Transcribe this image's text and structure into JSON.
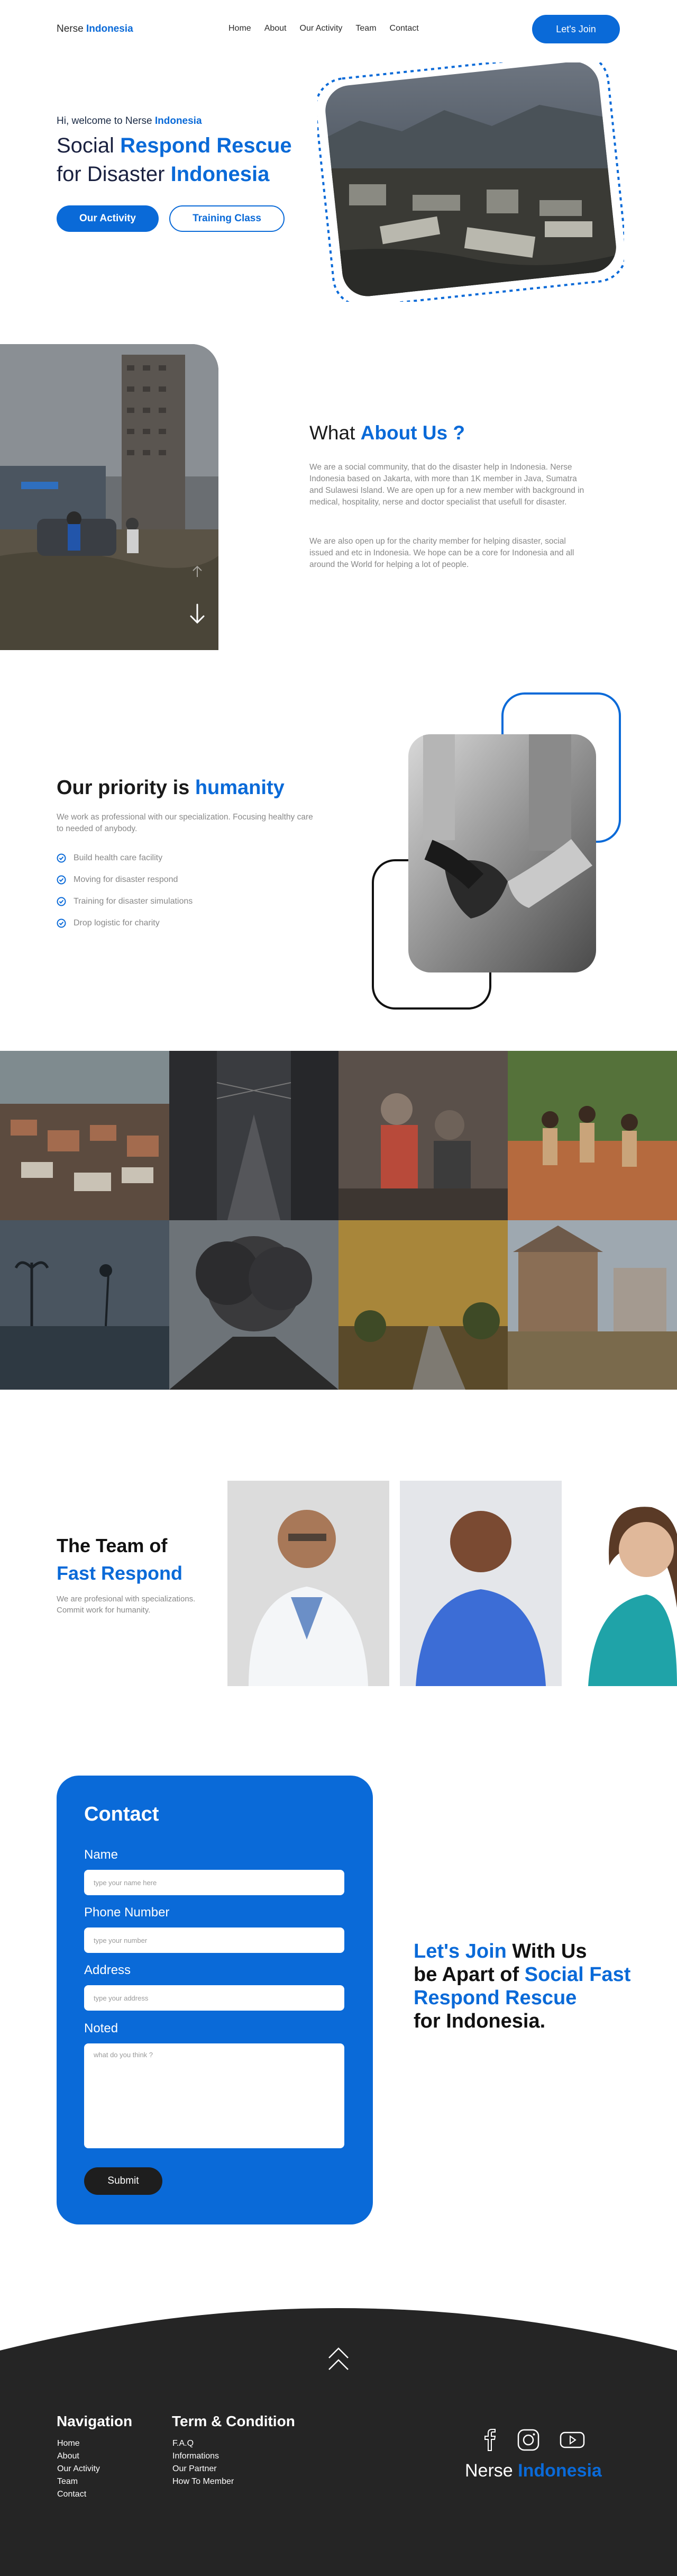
{
  "nav": {
    "brand_prefix": "Nerse ",
    "brand_accent": "Indonesia",
    "links": [
      "Home",
      "About",
      "Our Activity",
      "Team",
      "Contact"
    ],
    "join_label": "Let's Join"
  },
  "hero": {
    "greeting_prefix": "Hi, welcome to Nerse ",
    "greeting_accent": "Indonesia",
    "title_line1_prefix": "Social ",
    "title_line1_accent": "Respond Rescue",
    "title_line2_prefix": "for Disaster ",
    "title_line2_accent": "Indonesia",
    "btn_activity": "Our Activity",
    "btn_training": "Training Class"
  },
  "about": {
    "title_prefix": "What ",
    "title_accent": "About Us ?",
    "p1": "We are a social community, that do the disaster help in Indonesia. Nerse Indonesia based on Jakarta, with more than 1K member in Java, Sumatra and Sulawesi Island. We are open up for a new member with background in medical, hospitality, nerse and doctor specialist that usefull for disaster.",
    "p2": "We are also open up for the charity member for helping disaster, social issued and etc in Indonesia. We hope can be a core for Indonesia and all around the World for helping a lot of people."
  },
  "priority": {
    "title_prefix": "Our priority is ",
    "title_accent": "humanity",
    "description": "We work as professional with our specialization. Focusing healthy care to needed of anybody.",
    "items": [
      "Build health care facility",
      "Moving for disaster respond",
      "Training for disaster simulations",
      "Drop logistic for charity"
    ]
  },
  "team": {
    "title_line1": "The Team of",
    "title_line2": "Fast Respond",
    "description": "We are profesional with specializations. Commit work for humanity."
  },
  "contact": {
    "heading": "Contact",
    "fields": [
      {
        "label": "Name",
        "placeholder": "type your name here"
      },
      {
        "label": "Phone Number",
        "placeholder": "type your number"
      },
      {
        "label": "Address",
        "placeholder": "type your address"
      },
      {
        "label": "Noted",
        "placeholder": "what do you think ?"
      }
    ],
    "submit_label": "Submit",
    "join_accent1": "Let's Join",
    "join_text1": " With Us",
    "join_text2": "be Apart of ",
    "join_accent2": "Social Fast Respond Rescue",
    "join_text3": "for Indonesia."
  },
  "footer": {
    "nav_heading": "Navigation",
    "nav_links": [
      "Home",
      "About",
      "Our Activity",
      "Team",
      "Contact"
    ],
    "terms_heading": "Term & Condition",
    "terms_links": [
      "F.A.Q",
      "Informations",
      "Our Partner",
      "How To Member"
    ],
    "brand_prefix": "Nerse ",
    "brand_accent": "Indonesia",
    "social_icons": [
      "facebook-icon",
      "instagram-icon",
      "youtube-icon"
    ]
  },
  "colors": {
    "accent": "#0a6ad8",
    "dark": "#2b2b2b",
    "muted": "#888888"
  }
}
